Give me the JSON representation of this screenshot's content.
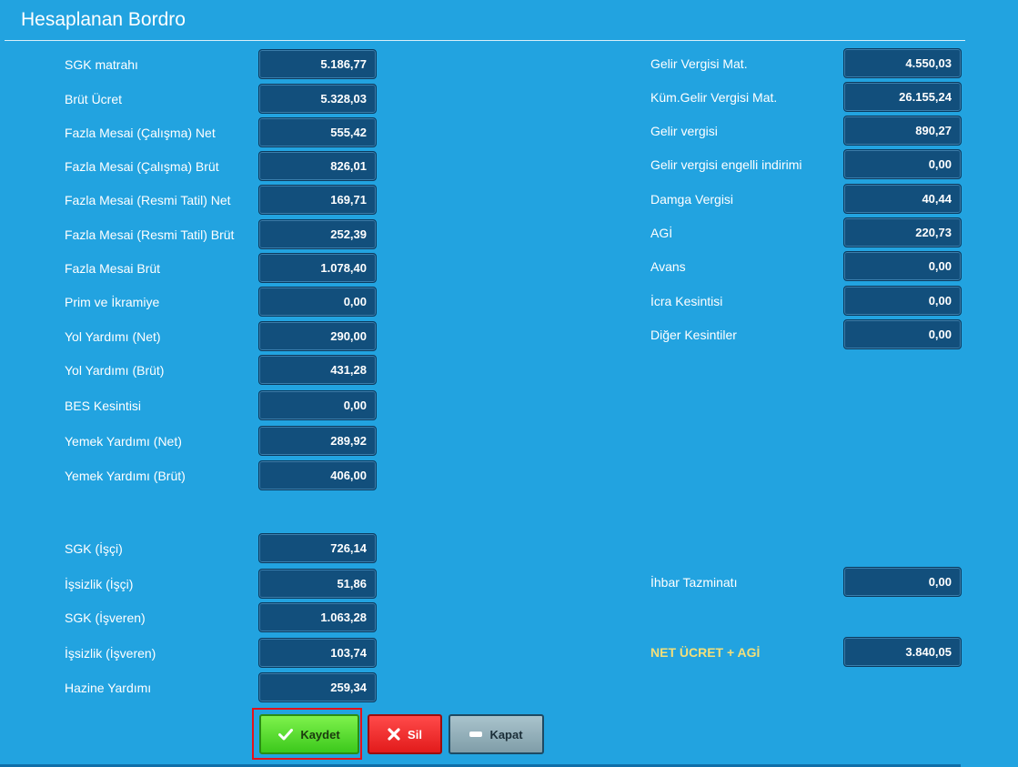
{
  "window": {
    "title": "Hesaplanan Bordro"
  },
  "left_fields": [
    {
      "label": "SGK matrahı",
      "value": "5.186,77"
    },
    {
      "label": "Brüt Ücret",
      "value": "5.328,03"
    },
    {
      "label": "Fazla Mesai (Çalışma) Net",
      "value": "555,42"
    },
    {
      "label": "Fazla Mesai (Çalışma) Brüt",
      "value": "826,01"
    },
    {
      "label": "Fazla Mesai (Resmi Tatil) Net",
      "value": "169,71"
    },
    {
      "label": "Fazla Mesai (Resmi Tatil) Brüt",
      "value": "252,39"
    },
    {
      "label": "Fazla Mesai Brüt",
      "value": "1.078,40"
    },
    {
      "label": "Prim ve İkramiye",
      "value": "0,00"
    },
    {
      "label": "Yol Yardımı (Net)",
      "value": "290,00"
    },
    {
      "label": "Yol Yardımı (Brüt)",
      "value": "431,28"
    },
    {
      "label": "BES Kesintisi",
      "value": "0,00"
    },
    {
      "label": "Yemek Yardımı (Net)",
      "value": "289,92"
    },
    {
      "label": "Yemek Yardımı (Brüt)",
      "value": "406,00"
    },
    {
      "label": "SGK (İşçi)",
      "value": "726,14"
    },
    {
      "label": "İşsizlik (İşçi)",
      "value": "51,86"
    },
    {
      "label": "SGK (İşveren)",
      "value": "1.063,28"
    },
    {
      "label": "İşsizlik (İşveren)",
      "value": "103,74"
    },
    {
      "label": "Hazine Yardımı",
      "value": "259,34"
    }
  ],
  "right_fields": [
    {
      "label": "Gelir Vergisi Mat.",
      "value": "4.550,03"
    },
    {
      "label": "Küm.Gelir Vergisi Mat.",
      "value": "26.155,24"
    },
    {
      "label": "Gelir vergisi",
      "value": "890,27"
    },
    {
      "label": "Gelir vergisi engelli indirimi",
      "value": "0,00"
    },
    {
      "label": "Damga Vergisi",
      "value": "40,44"
    },
    {
      "label": "AGİ",
      "value": "220,73"
    },
    {
      "label": "Avans",
      "value": "0,00"
    },
    {
      "label": "İcra Kesintisi",
      "value": "0,00"
    },
    {
      "label": "Diğer Kesintiler",
      "value": "0,00"
    },
    {
      "label": "İhbar Tazminatı",
      "value": "0,00"
    },
    {
      "label": "NET ÜCRET + AGİ",
      "value": "3.840,05"
    }
  ],
  "buttons": {
    "save": {
      "label": "Kaydet",
      "icon": "check-icon",
      "color": "#4fd52a"
    },
    "delete": {
      "label": "Sil",
      "icon": "x-icon",
      "color": "#ef2b2b"
    },
    "close": {
      "label": "Kapat",
      "icon": "minus-icon",
      "color": "#93b0ba"
    }
  },
  "colors": {
    "background": "#22a3e0",
    "field": "#124f7c",
    "net_label": "#f3df7a"
  }
}
